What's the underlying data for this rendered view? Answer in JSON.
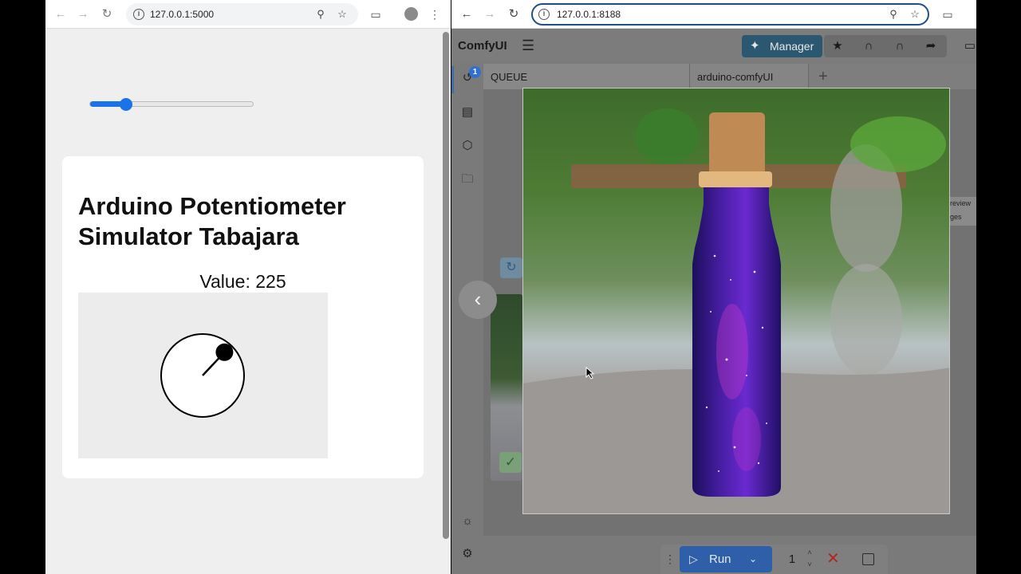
{
  "left_window": {
    "url": "127.0.0.1:5000",
    "slider_value": 225,
    "slider_max": 1023,
    "page_title": "Arduino Potentiometer Simulator Tabajara",
    "value_text": "Value: 225"
  },
  "right_window": {
    "url": "127.0.0.1:8188",
    "app_title": "ComfyUI",
    "manager_label": "Manager",
    "queue_badge": "1",
    "tabs": [
      {
        "label": "QUEUE"
      },
      {
        "label": "arduino-comfyUI"
      }
    ],
    "side_label_lines": [
      "review",
      "ges"
    ],
    "run_label": "Run",
    "batch_count": "1"
  },
  "colors": {
    "slider_accent": "#1a73e8",
    "manager_bg": "#2c5770",
    "run_bg": "#2f5fa8",
    "cancel": "#b3261e"
  }
}
